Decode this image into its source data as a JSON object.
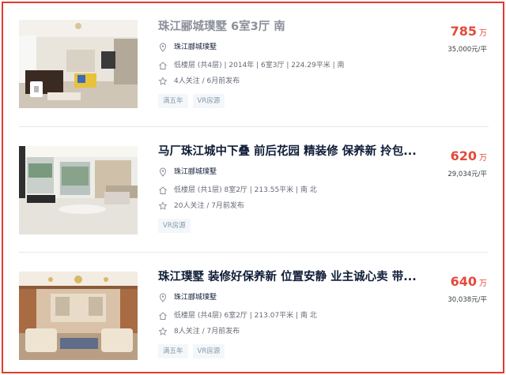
{
  "listings": [
    {
      "title": "珠江郦城璞墅 6室3厅 南",
      "community": "珠江郦城璞墅",
      "info": "低楼层 (共4层) | 2014年 | 6室3厅 | 224.29平米 | 南",
      "follow": "4人关注 / 6月前发布",
      "tags": [
        "满五年",
        "VR房源"
      ],
      "price": "785",
      "price_unit": "万",
      "unit_price": "35,000元/平"
    },
    {
      "title": "马厂珠江城中下叠 前后花园 精装修 保养新 拎包...",
      "community": "珠江郦城璞墅",
      "info": "低楼层 (共1层) 8室2厅 | 213.55平米 | 南 北",
      "follow": "20人关注 / 7月前发布",
      "tags": [
        "VR房源"
      ],
      "price": "620",
      "price_unit": "万",
      "unit_price": "29,034元/平"
    },
    {
      "title": "珠江璞墅 装修好保养新 位置安静 业主诚心卖 带...",
      "community": "珠江郦城璞墅",
      "info": "低楼层 (共4层) 6室2厅 | 213.07平米 | 南 北",
      "follow": "8人关注 / 7月前发布",
      "tags": [
        "满五年",
        "VR房源"
      ],
      "price": "640",
      "price_unit": "万",
      "unit_price": "30,038元/平"
    }
  ],
  "icons": {
    "community": "location-pin-icon",
    "info": "house-icon",
    "follow": "star-icon"
  },
  "colors": {
    "border": "#e23a2f",
    "price": "#e44a3b",
    "title": "#101d37",
    "title_visited": "#8c909a",
    "tag_text": "#849aae",
    "tag_bg": "#f4f7f9"
  }
}
